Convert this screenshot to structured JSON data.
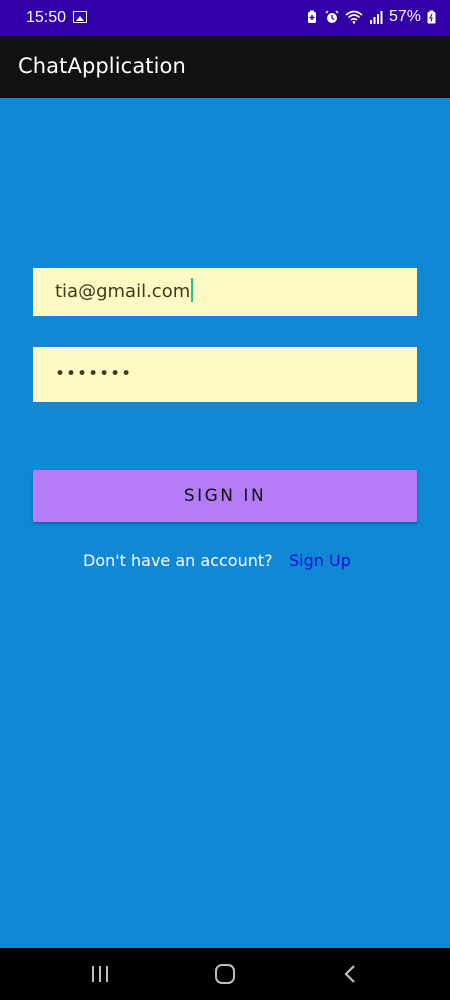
{
  "status_bar": {
    "time": "15:50",
    "battery": "57%",
    "icons": [
      "image-icon",
      "battery-saver-icon",
      "alarm-icon",
      "wifi-icon",
      "signal-icon",
      "battery-icon"
    ]
  },
  "app_bar": {
    "title": "ChatApplication"
  },
  "login_form": {
    "email_value": "tia@gmail.com",
    "password_value": "•••••••",
    "signin_label": "SIGN IN",
    "account_prompt": "Don't have an account?",
    "signup_label": "Sign Up"
  },
  "nav_bar": {
    "icons": [
      "recents-icon",
      "home-icon",
      "back-icon"
    ]
  },
  "colors": {
    "background": "#0f88d6",
    "status_bar": "#3200a8",
    "app_bar": "#121212",
    "input_background": "#fff9c4",
    "button": "#b57cf7",
    "link": "#1a0bd8"
  }
}
